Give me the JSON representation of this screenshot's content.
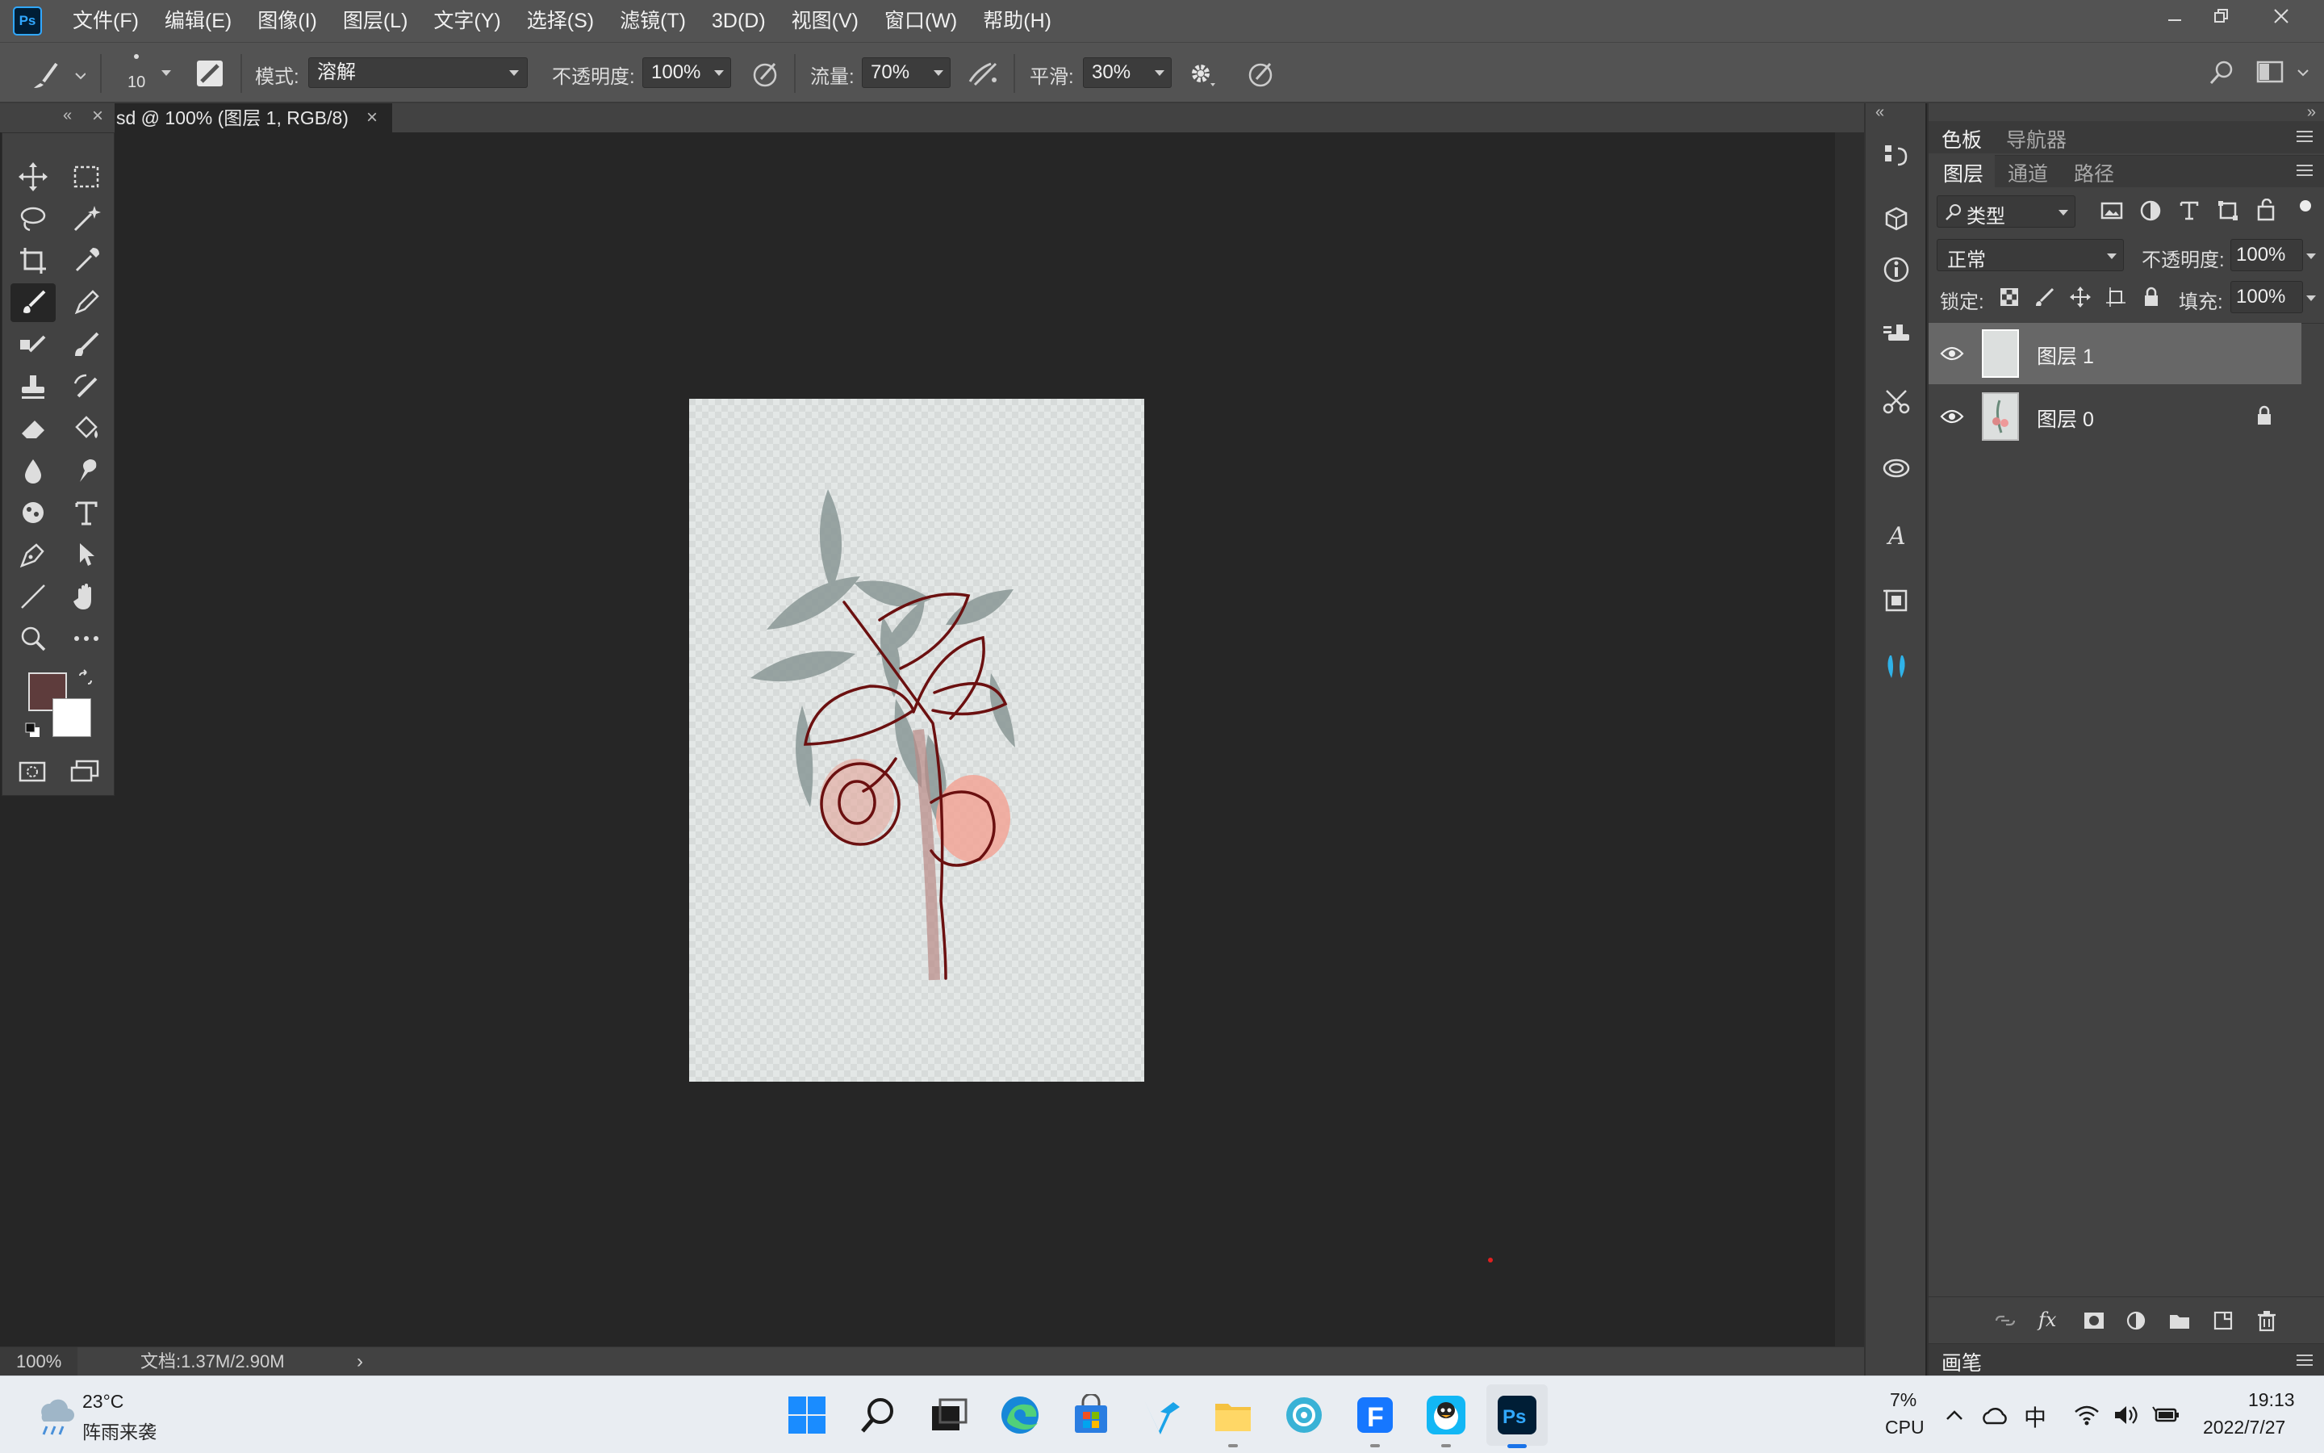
{
  "app": {
    "logo": "Ps",
    "menu": [
      "文件(F)",
      "编辑(E)",
      "图像(I)",
      "图层(L)",
      "文字(Y)",
      "选择(S)",
      "滤镜(T)",
      "3D(D)",
      "视图(V)",
      "窗口(W)",
      "帮助(H)"
    ]
  },
  "options": {
    "brush_size": "10",
    "mode_label": "模式:",
    "mode_value": "溶解",
    "opacity_label": "不透明度:",
    "opacity_value": "100%",
    "flow_label": "流量:",
    "flow_value": "70%",
    "smoothing_label": "平滑:",
    "smoothing_value": "30%"
  },
  "document": {
    "tab_title": "sd @ 100% (图层 1, RGB/8)",
    "zoom": "100%",
    "doc_info": "文档:1.37M/2.90M"
  },
  "colors": {
    "foreground": "#5e3c3c",
    "background": "#ffffff",
    "accent": "#31a8ff",
    "sketch_line": "#6b1010"
  },
  "panels": {
    "top_tabs": [
      "色板",
      "导航器"
    ],
    "layer_tabs": [
      "图层",
      "通道",
      "路径"
    ],
    "filter_kind": "类型",
    "blend_mode": "正常",
    "opacity_label": "不透明度:",
    "opacity_value": "100%",
    "lock_label": "锁定:",
    "fill_label": "填充:",
    "fill_value": "100%",
    "layers": [
      {
        "name": "图层 1",
        "selected": true,
        "locked": false
      },
      {
        "name": "图层 0",
        "selected": false,
        "locked": true
      }
    ],
    "bottom_panel": "画笔"
  },
  "taskbar": {
    "weather_temp": "23°C",
    "weather_desc": "阵雨来袭",
    "cpu_value": "7%",
    "cpu_label": "CPU",
    "ime": "中",
    "time": "19:13",
    "date": "2022/7/27"
  }
}
